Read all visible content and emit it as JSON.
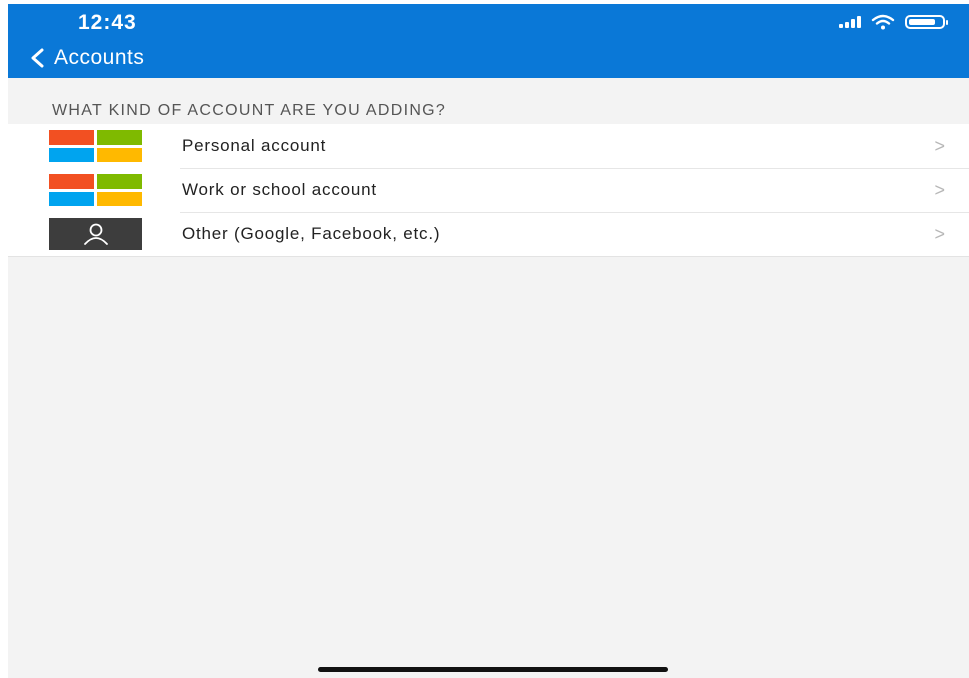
{
  "status_bar": {
    "time": "12:43",
    "battery_level": 0.8
  },
  "nav": {
    "back_label": "Accounts",
    "back_icon": "chevron-left-icon"
  },
  "section_header": "WHAT KIND OF ACCOUNT ARE YOU ADDING?",
  "accounts": [
    {
      "label": "Personal account",
      "icon": "microsoft-logo-icon",
      "chevron": ">"
    },
    {
      "label": "Work or school account",
      "icon": "microsoft-logo-icon",
      "chevron": ">"
    },
    {
      "label": "Other (Google, Facebook, etc.)",
      "icon": "person-icon",
      "chevron": ">"
    }
  ],
  "colors": {
    "header_bg": "#0a78d7",
    "ms_red": "#f25022",
    "ms_green": "#7fba00",
    "ms_blue": "#00a4ef",
    "ms_yellow": "#ffb900",
    "other_icon_bg": "#3d3d3d"
  }
}
